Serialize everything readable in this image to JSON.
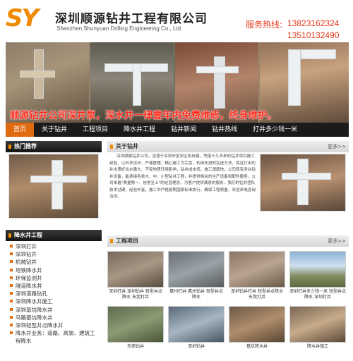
{
  "header": {
    "logo": "SY",
    "company_cn": "深圳顺源钻井工程有限公司",
    "company_en": "Shenzhen Shunyuan Drilling Engineering Co., Ltd.",
    "hotline_label": "服务热线:",
    "hotline_1": "13823162324",
    "hotline_2": "13510132490"
  },
  "banner": {
    "slogan": "顺源钻井公司深井泵，深水井一律壹年内免费维修，终身维护。"
  },
  "nav": {
    "items": [
      "首页",
      "关于钻井",
      "工程项目",
      "降水井工程",
      "钻井新闻",
      "钻井热线",
      "打井多少钱一米"
    ]
  },
  "sections": {
    "hot": "热门推荐",
    "about": "关于钻井",
    "categories": "降水井工程",
    "projects": "工程项目",
    "more": "更多>>"
  },
  "about_text": "深圳顺源钻井公司，坐落于深圳市宝安区松岗镇，凭借十几年来的钻井项目施工经验，以科学设计、严格管理、精心施工为宗旨，利用先进的钻进方法，保证打出的井水质好出水量大、不受地质环境影响，钻井成本低，施工速度快。公司现有多台钻井设备，能承接各类大、中、小型钻井工程，并提供相关的生产设备和配件服务，公司本着\"质量第一、信誉至上\"的经营理念，为客户提供满意的服务。我们的钻井团队技术过硬，经验丰富，施工中严格按照国家标准执行，确保工程质量，欢迎来电咨询洽谈。",
  "categories": [
    "深圳打井",
    "深圳钻井",
    "机械钻井",
    "地铁降水井",
    "环保监测井",
    "隧道降水井",
    "深圳道路钻孔",
    "深圳降水井施工",
    "深圳基坑降水井",
    "马路基坑降水井",
    "深圳轻型井点降水井",
    "降水井业务：道路、高架、建筑工程降水"
  ],
  "projects": [
    "深圳打井 深圳钻井 轻型井点降水 东莞打井",
    "惠州打井 惠州钻井 轻型井点降水",
    "深圳钻井打井 轻型井点降水 东莞打井",
    "深圳打井多少钱一米 轻型井点降水 深圳打井",
    "东莞钻井",
    "深圳钻井",
    "基坑降水井",
    "降水井施工"
  ]
}
